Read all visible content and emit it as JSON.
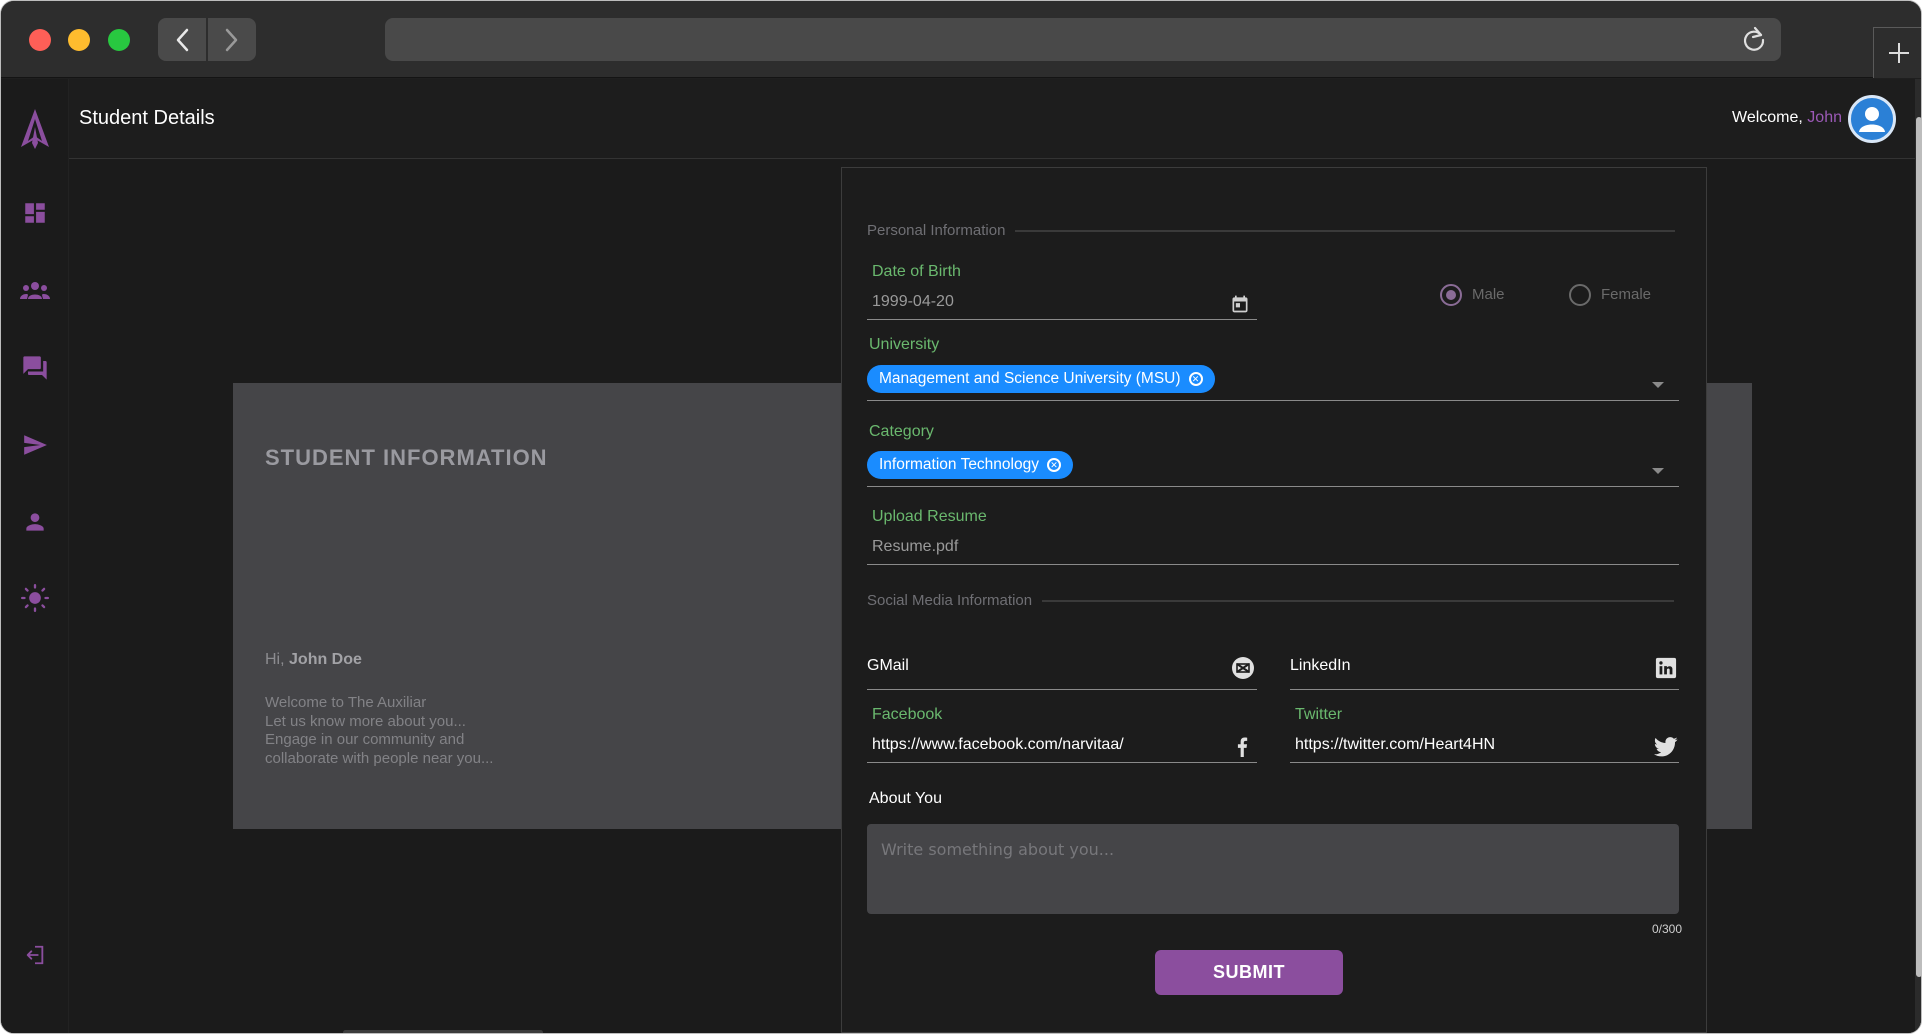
{
  "browser": {
    "back_glyph": "‹",
    "forward_glyph": "›",
    "new_tab_glyph": "+"
  },
  "header": {
    "page_title": "Student Details",
    "welcome_prefix": "Welcome,",
    "user_name": "John"
  },
  "sidebar": {
    "items": [
      "logo-icon",
      "dashboard-icon",
      "groups-icon",
      "forum-icon",
      "send-icon",
      "person-icon",
      "theme-icon",
      "logout-icon"
    ]
  },
  "info_card": {
    "title": "STUDENT INFORMATION",
    "greeting_prefix": "Hi,",
    "greeting_name": "John Doe",
    "lines": [
      "Welcome to The Auxiliar",
      "Let us know more about you...",
      "Engage in our community and",
      "collaborate with people near you..."
    ]
  },
  "form": {
    "personal_section": "Personal Information",
    "dob_label": "Date of Birth",
    "dob_value": "1999-04-20",
    "gender_options": [
      "Male",
      "Female"
    ],
    "gender_selected": "Male",
    "university_label": "University",
    "university_chip": "Management and Science University (MSU)",
    "category_label": "Category",
    "category_chip": "Information Technology",
    "resume_label": "Upload Resume",
    "resume_value": "Resume.pdf",
    "social_section": "Social Media Information",
    "gmail_label": "GMail",
    "linkedin_label": "LinkedIn",
    "facebook_label": "Facebook",
    "facebook_value": "https://www.facebook.com/narvitaa/",
    "twitter_label": "Twitter",
    "twitter_value": "https://twitter.com/Heart4HN",
    "about_label": "About You",
    "about_placeholder": "Write something about you...",
    "about_counter": "0/300",
    "submit_label": "SUBMIT"
  },
  "colors": {
    "accent_purple": "#8b4e9e",
    "chip_blue": "#1a8cff",
    "label_green": "#6ab86e"
  }
}
